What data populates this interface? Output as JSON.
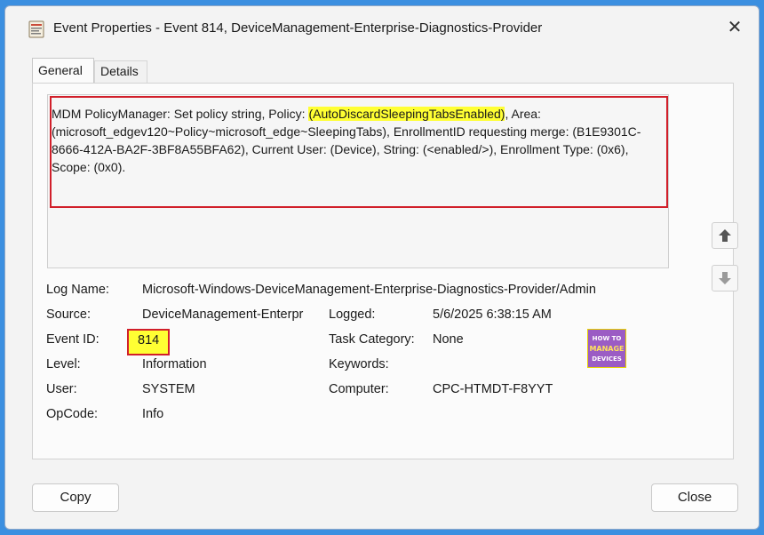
{
  "window": {
    "title": "Event Properties - Event 814, DeviceManagement-Enterprise-Diagnostics-Provider"
  },
  "tabs": [
    {
      "label": "General",
      "selected": true
    },
    {
      "label": "Details",
      "selected": false
    }
  ],
  "message": {
    "part1": "MDM PolicyManager: Set policy string, Policy: ",
    "highlight": "(AutoDiscardSleepingTabsEnabled)",
    "part2": ", Area: (microsoft_edgev120~Policy~microsoft_edge~SleepingTabs), EnrollmentID requesting merge: (B1E9301C-8666-412A-BA2F-3BF8A55BFA62), Current User: (Device), String: (<enabled/>), Enrollment Type: (0x6), Scope: (0x0)."
  },
  "fields": {
    "log_name": {
      "label": "Log Name:",
      "value": "Microsoft-Windows-DeviceManagement-Enterprise-Diagnostics-Provider/Admin"
    },
    "source": {
      "label": "Source:",
      "value": "DeviceManagement-Enterpr"
    },
    "logged": {
      "label": "Logged:",
      "value": "5/6/2025 6:38:15 AM"
    },
    "event_id": {
      "label": "Event ID:",
      "value": "814"
    },
    "task_category": {
      "label": "Task Category:",
      "value": "None"
    },
    "level": {
      "label": "Level:",
      "value": "Information"
    },
    "keywords": {
      "label": "Keywords:",
      "value": ""
    },
    "user": {
      "label": "User:",
      "value": "SYSTEM"
    },
    "computer": {
      "label": "Computer:",
      "value": "CPC-HTMDT-F8YYT"
    },
    "opcode": {
      "label": "OpCode:",
      "value": "Info"
    }
  },
  "watermark": {
    "line1": "HOW TO",
    "line2": "MANAGE",
    "line3": "DEVICES"
  },
  "buttons": {
    "copy": "Copy",
    "close": "Close"
  },
  "icons": {
    "app": "event-viewer-icon",
    "close": "close-icon",
    "up": "arrow-up-icon",
    "down": "arrow-down-icon"
  },
  "colors": {
    "highlight": "#ffff33",
    "annotation_border": "#d11f2a",
    "background": "#3b8fe0"
  }
}
